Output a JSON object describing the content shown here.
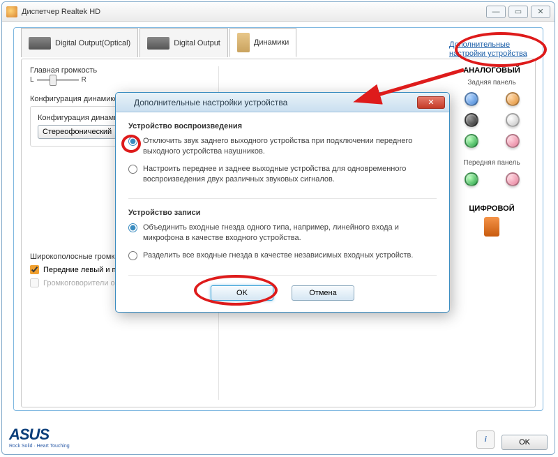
{
  "window": {
    "title": "Диспетчер Realtek HD",
    "min": "—",
    "max": "▭",
    "close": "✕"
  },
  "tabs": [
    {
      "label": "Digital Output(Optical)"
    },
    {
      "label": "Digital Output"
    },
    {
      "label": "Динамики"
    }
  ],
  "top_link": "Дополнительные настройки устройства",
  "volume": {
    "label": "Главная громкость",
    "L": "L",
    "R": "R"
  },
  "config": {
    "title": "Конфигурация динамиков",
    "sub_title": "Конфигурация динамиков",
    "combo": "Стереофонический"
  },
  "wideband": {
    "title": "Широкополосные громкоговорители",
    "front": "Передние левый и правый",
    "surround": "Громкоговорители объемного звука"
  },
  "jacks": {
    "analog": "АНАЛОГОВЫЙ",
    "back": "Задняя панель",
    "front": "Передняя панель",
    "digital": "ЦИФРОВОЙ"
  },
  "asus": {
    "brand": "ASUS",
    "tag": "Rock Solid · Heart Touching"
  },
  "footer": {
    "ok": "OK",
    "info": "i"
  },
  "modal": {
    "title": "Дополнительные настройки устройства",
    "close": "✕",
    "playback": {
      "title": "Устройство воспроизведения",
      "opt1": "Отключить звук заднего выходного устройства при подключении переднего выходного устройства наушников.",
      "opt2": "Настроить переднее и заднее выходные устройства для одновременного воспроизведения двух различных звуковых сигналов."
    },
    "record": {
      "title": "Устройство записи",
      "opt1": "Объединить входные гнезда одного типа, например, линейного входа и микрофона в качестве входного устройства.",
      "opt2": "Разделить все входные гнезда в качестве независимых входных устройств."
    },
    "ok": "OK",
    "cancel": "Отмена"
  }
}
